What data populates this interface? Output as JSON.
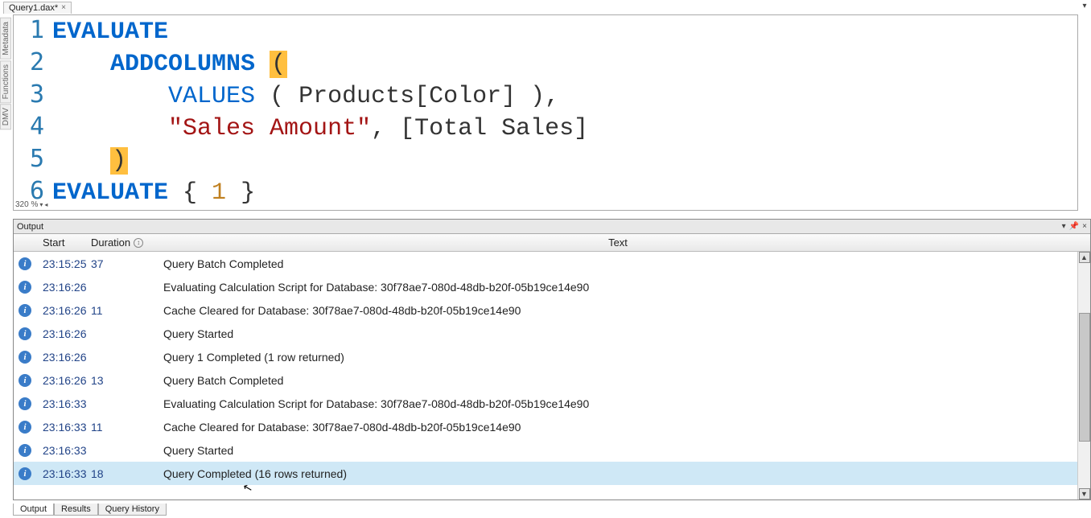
{
  "tab": {
    "label": "Query1.dax*",
    "close": "×"
  },
  "side_tabs": [
    "Metadata",
    "Functions",
    "DMV"
  ],
  "editor": {
    "zoom_label": "320 %",
    "lines": [
      {
        "n": "1",
        "tokens": [
          {
            "t": "EVALUATE",
            "c": "kw"
          }
        ]
      },
      {
        "n": "2",
        "tokens": [
          {
            "t": "    ",
            "c": "plain"
          },
          {
            "t": "ADDCOLUMNS",
            "c": "kw"
          },
          {
            "t": " ",
            "c": "plain"
          },
          {
            "t": "(",
            "c": "paren-hi"
          }
        ]
      },
      {
        "n": "3",
        "tokens": [
          {
            "t": "        ",
            "c": "plain"
          },
          {
            "t": "VALUES",
            "c": "fn"
          },
          {
            "t": " ( Products[Color] ),",
            "c": "plain"
          }
        ]
      },
      {
        "n": "4",
        "tokens": [
          {
            "t": "        ",
            "c": "plain"
          },
          {
            "t": "\"Sales Amount\"",
            "c": "str"
          },
          {
            "t": ", [Total Sales]",
            "c": "plain"
          }
        ]
      },
      {
        "n": "5",
        "tokens": [
          {
            "t": "    ",
            "c": "plain"
          },
          {
            "t": ")",
            "c": "paren-hi"
          }
        ]
      },
      {
        "n": "6",
        "tokens": [
          {
            "t": "EVALUATE",
            "c": "kw"
          },
          {
            "t": " { ",
            "c": "plain"
          },
          {
            "t": "1",
            "c": "num"
          },
          {
            "t": " }",
            "c": "plain"
          }
        ]
      }
    ]
  },
  "output": {
    "title": "Output",
    "columns": {
      "start": "Start",
      "duration": "Duration",
      "text": "Text"
    },
    "rows": [
      {
        "start": "23:15:25",
        "dur": "37",
        "text": "Query Batch Completed"
      },
      {
        "start": "23:16:26",
        "dur": "",
        "text": "Evaluating Calculation Script for Database: 30f78ae7-080d-48db-b20f-05b19ce14e90"
      },
      {
        "start": "23:16:26",
        "dur": "11",
        "text": "Cache Cleared for Database: 30f78ae7-080d-48db-b20f-05b19ce14e90"
      },
      {
        "start": "23:16:26",
        "dur": "",
        "text": "Query Started"
      },
      {
        "start": "23:16:26",
        "dur": "",
        "text": "Query 1 Completed (1 row returned)"
      },
      {
        "start": "23:16:26",
        "dur": "13",
        "text": "Query Batch Completed"
      },
      {
        "start": "23:16:33",
        "dur": "",
        "text": "Evaluating Calculation Script for Database: 30f78ae7-080d-48db-b20f-05b19ce14e90"
      },
      {
        "start": "23:16:33",
        "dur": "11",
        "text": "Cache Cleared for Database: 30f78ae7-080d-48db-b20f-05b19ce14e90"
      },
      {
        "start": "23:16:33",
        "dur": "",
        "text": "Query Started"
      },
      {
        "start": "23:16:33",
        "dur": "18",
        "text": "Query Completed (16 rows returned)",
        "selected": true
      }
    ]
  },
  "bottom_tabs": [
    "Output",
    "Results",
    "Query History"
  ],
  "icons": {
    "info_glyph": "i"
  }
}
